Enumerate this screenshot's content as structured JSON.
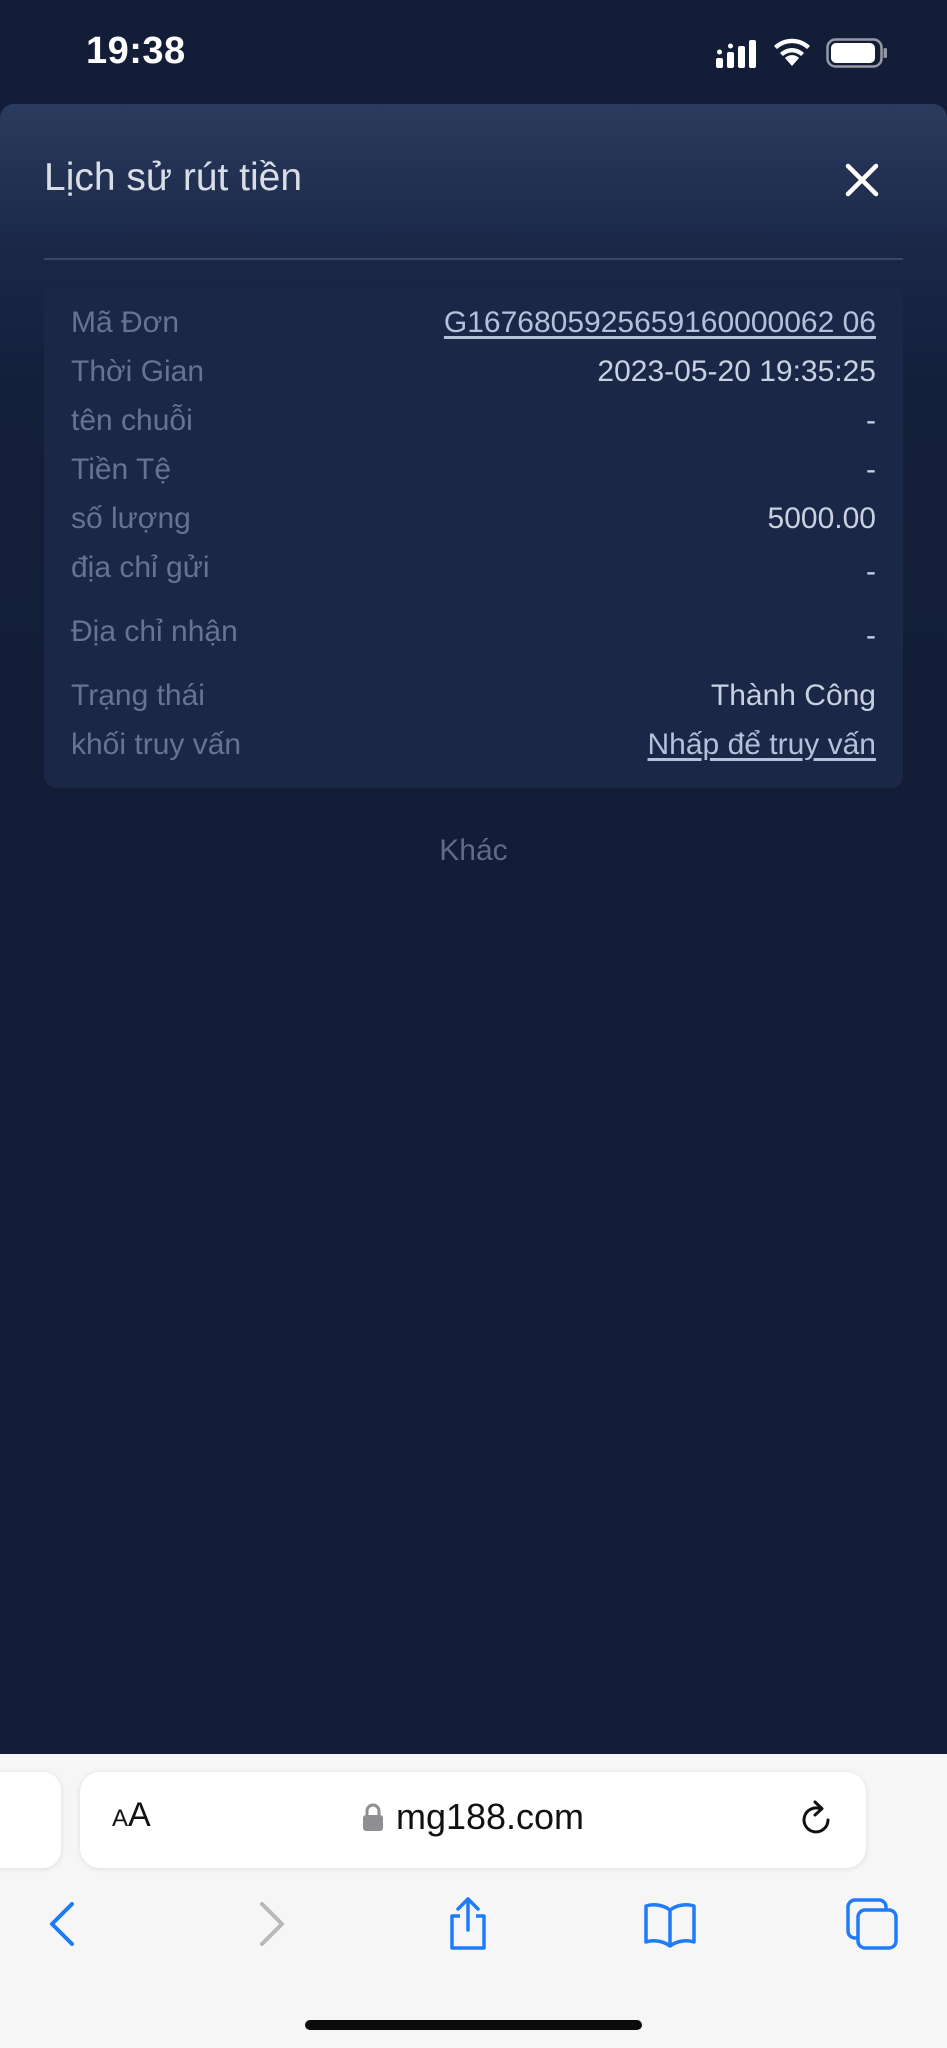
{
  "status_bar": {
    "time": "19:38"
  },
  "sheet": {
    "title": "Lịch sử rút tiền",
    "rows": [
      {
        "label": "Mã Đơn",
        "value": "G1676805925659160000062 06"
      },
      {
        "label": "Thời Gian",
        "value": "2023-05-20 19:35:25"
      },
      {
        "label": "tên chuỗi",
        "value": "-"
      },
      {
        "label": "Tiền Tệ",
        "value": "-"
      },
      {
        "label": "số lượng",
        "value": "5000.00"
      },
      {
        "label": "địa chỉ gửi",
        "value": "-"
      },
      {
        "label": "Địa chỉ nhận",
        "value": "-"
      },
      {
        "label": "Trạng thái",
        "value": "Thành Công"
      },
      {
        "label": "khối truy vấn",
        "value": "Nhấp để truy vấn"
      }
    ],
    "more_label": "Khác"
  },
  "browser": {
    "aa_label_small": "A",
    "aa_label_large": "A",
    "url": "mg188.com"
  },
  "colors": {
    "background": "#131d37",
    "card": "#1a2747",
    "label": "#66748f",
    "value": "#c9d1e0",
    "browser_bar": "#f6f6f7",
    "toolbar_blue": "#1f7bf6"
  }
}
